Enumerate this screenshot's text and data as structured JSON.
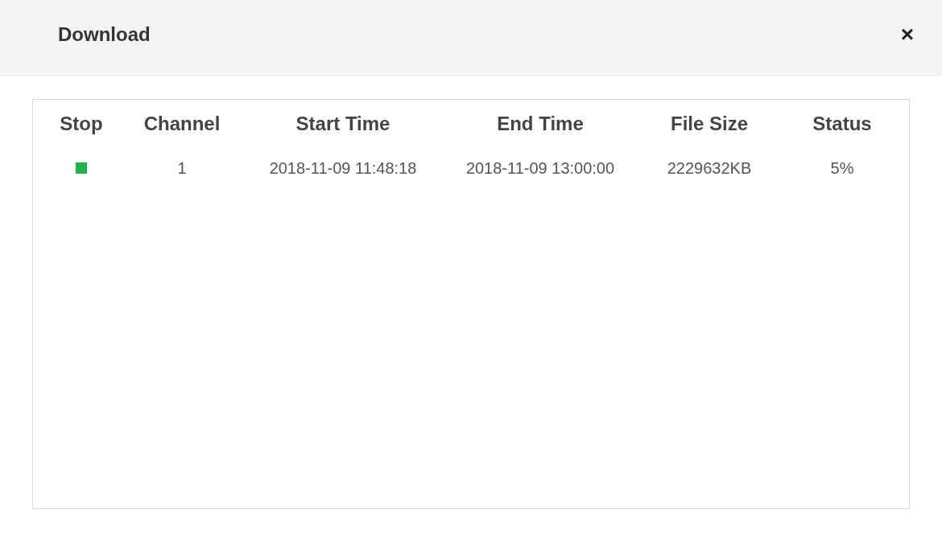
{
  "dialog": {
    "title": "Download",
    "close": "×"
  },
  "table": {
    "columns": [
      "Stop",
      "Channel",
      "Start Time",
      "End Time",
      "File Size",
      "Status"
    ],
    "rows": [
      {
        "channel": "1",
        "start_time": "2018-11-09 11:48:18",
        "end_time": "2018-11-09 13:00:00",
        "file_size": "2229632KB",
        "status": "5%"
      }
    ]
  }
}
